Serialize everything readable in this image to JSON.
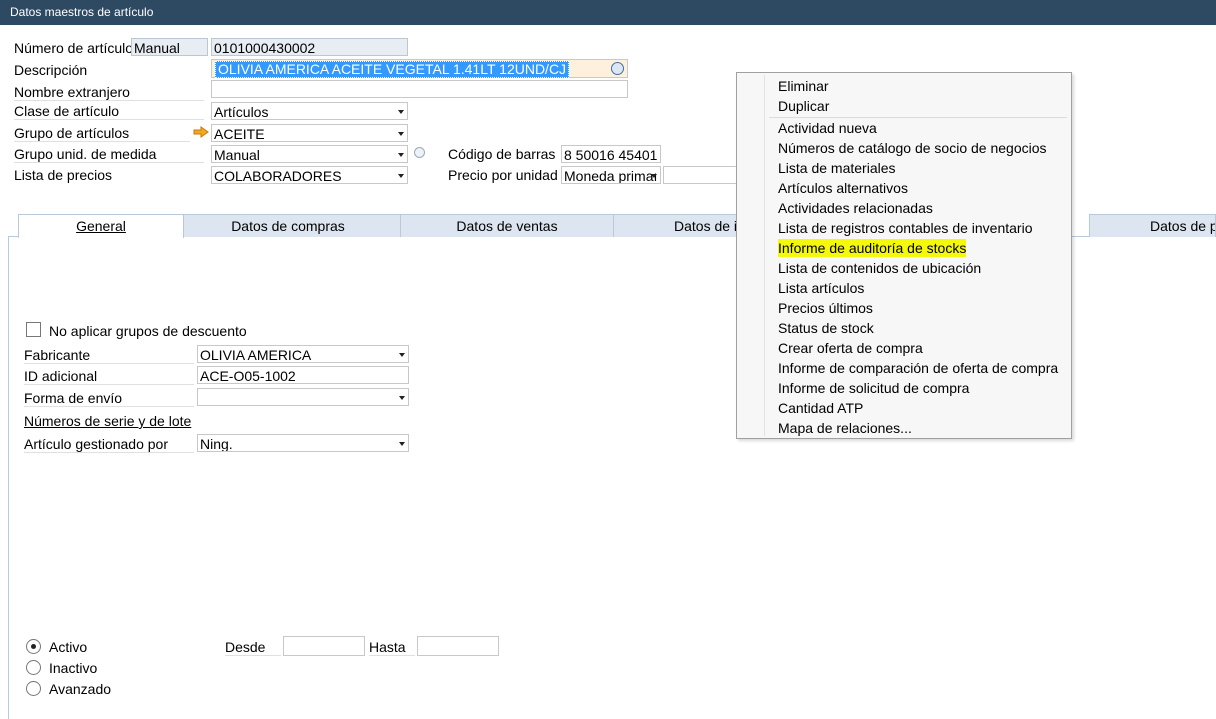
{
  "window": {
    "title": "Datos maestros de artículo"
  },
  "header": {
    "numero_label": "Número de artículo",
    "numero_mode": "Manual",
    "numero_value": "0101000430002",
    "descripcion_label": "Descripción",
    "descripcion_value": "OLIVIA AMERICA ACEITE VEGETAL 1.41LT 12UND/CJ",
    "nombre_ext_label": "Nombre extranjero",
    "nombre_ext_value": "",
    "clase_label": "Clase de artículo",
    "clase_value": "Artículos",
    "grupo_label": "Grupo de artículos",
    "grupo_value": "ACEITE",
    "grupo_unid_label": "Grupo unid. de medida",
    "grupo_unid_value": "Manual",
    "lista_precios_label": "Lista de precios",
    "lista_precios_value": "COLABORADORES",
    "codigo_barras_label": "Código de barras",
    "codigo_barras_value": "8 50016 45401",
    "precio_unidad_label": "Precio por unidad",
    "precio_unidad_currency": "Moneda primaı",
    "precio_unidad_value": ""
  },
  "tabs": [
    {
      "label": "General"
    },
    {
      "label": "Datos de compras"
    },
    {
      "label": "Datos de ventas"
    },
    {
      "label": "Datos de i"
    },
    {
      "label": "Datos de p"
    }
  ],
  "general": {
    "no_descuento_label": "No aplicar grupos de descuento",
    "fabricante_label": "Fabricante",
    "fabricante_value": "OLIVIA AMERICA",
    "id_adicional_label": "ID adicional",
    "id_adicional_value": "ACE-O05-1002",
    "forma_envio_label": "Forma de envío",
    "forma_envio_value": "",
    "series_lote_label": "Números de serie y de lote",
    "gestionado_label": "Artículo gestionado por",
    "gestionado_value": "Ning.",
    "activo_label": "Activo",
    "inactivo_label": "Inactivo",
    "avanzado_label": "Avanzado",
    "desde_label": "Desde",
    "hasta_label": "Hasta"
  },
  "context_menu": {
    "items": [
      "Eliminar",
      "Duplicar",
      "Actividad nueva",
      "Números de catálogo de socio de negocios",
      "Lista de materiales",
      "Artículos alternativos",
      "Actividades relacionadas",
      "Lista de registros contables de inventario",
      "Informe de auditoría de stocks",
      "Lista de contenidos de ubicación",
      "Lista artículos",
      "Precios últimos",
      "Status de stock",
      "Crear oferta de compra",
      "Informe de comparación de oferta de compra",
      "Informe de solicitud de compra",
      "Cantidad ATP",
      "Mapa de relaciones..."
    ],
    "highlight_color": "#f4f80b"
  },
  "colors": {
    "titlebar": "#2e4a63",
    "selection": "#3399ff",
    "tab_inactive": "#dde6f0"
  }
}
